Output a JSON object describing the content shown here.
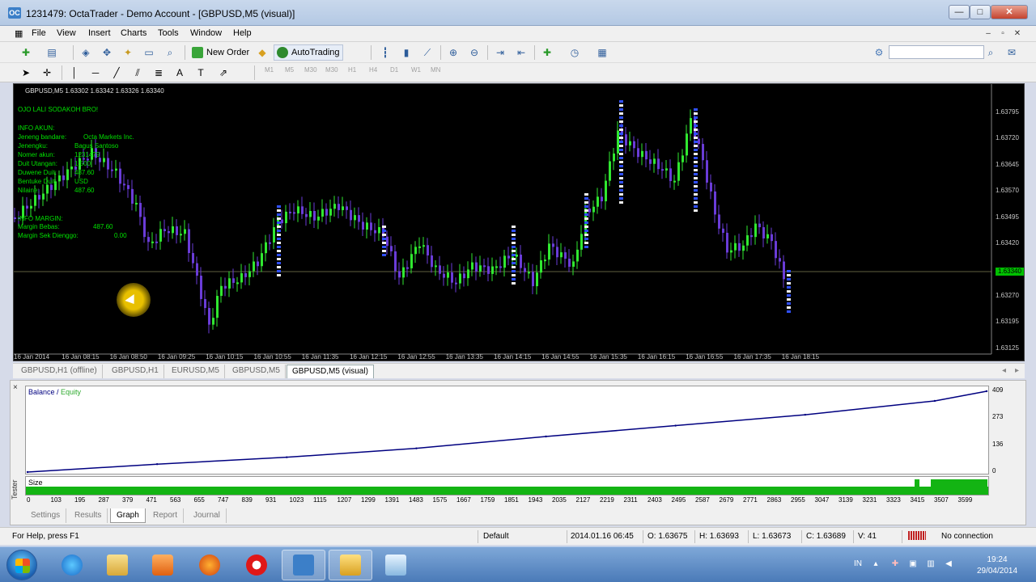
{
  "window": {
    "title": "1231479: OctaTrader - Demo Account - [GBPUSD,M5 (visual)]",
    "app_icon": "OC",
    "controls": {
      "minimize": "—",
      "maximize": "□",
      "close": "✕"
    },
    "mdi_controls": {
      "minimize": "–",
      "restore": "▫",
      "close": "✕"
    }
  },
  "menu": [
    "File",
    "View",
    "Insert",
    "Charts",
    "Tools",
    "Window",
    "Help"
  ],
  "toolbar": {
    "new_order": "New Order",
    "autotrading": "AutoTrading",
    "timeframes": [
      "M1",
      "M5",
      "M30",
      "H1",
      "H4",
      "D1",
      "W1",
      "MN"
    ],
    "search_placeholder": ""
  },
  "chart": {
    "header": "GBPUSD,M5  1.63302 1.63342 1.63326 1.63340",
    "overlay": {
      "line1": "OJO LALI SODAKOH BRO!",
      "info_akun": "INFO AKUN:",
      "rows": [
        {
          "label": "Jeneng bandare:",
          "value": "Octa Markets Inc."
        },
        {
          "label": "Jenengku:",
          "value": "Bagus Santoso"
        },
        {
          "label": "Nomer akun:",
          "value": "1231479"
        },
        {
          "label": "Duit Utangan:",
          "value": "1:500"
        },
        {
          "label": "Duwene Duit:",
          "value": "487.60"
        },
        {
          "label": "Bentuke Duit:",
          "value": "USD"
        },
        {
          "label": "Nilaine:",
          "value": "487.60"
        }
      ],
      "info_margin": "INFO MARGIN:",
      "margin_rows": [
        {
          "label": "Margin Bebas:",
          "value": "487.60"
        },
        {
          "label": "Margin Sek Dienggo:",
          "value": "0.00"
        }
      ]
    },
    "price_labels": [
      "1.63795",
      "1.63720",
      "1.63645",
      "1.63570",
      "1.63495",
      "1.63420",
      "1.63340",
      "1.63270",
      "1.63195",
      "1.63125"
    ],
    "current_price": "1.63340",
    "time_labels": [
      "16 Jan 2014",
      "16 Jan 08:15",
      "16 Jan 08:50",
      "16 Jan 09:25",
      "16 Jan 10:15",
      "16 Jan 10:55",
      "16 Jan 11:35",
      "16 Jan 12:15",
      "16 Jan 12:55",
      "16 Jan 13:35",
      "16 Jan 14:15",
      "16 Jan 14:55",
      "16 Jan 15:35",
      "16 Jan 16:15",
      "16 Jan 16:55",
      "16 Jan 17:35",
      "16 Jan 18:15"
    ],
    "colors": {
      "bull": "#30e830",
      "bear": "#6a3cd8",
      "grid": "#1e3a1e",
      "text": "#c8c8c8"
    }
  },
  "chart_tabs": [
    "GBPUSD,H1 (offline)",
    "GBPUSD,H1",
    "EURUSD,M5",
    "GBPUSD,M5",
    "GBPUSD,M5 (visual)"
  ],
  "active_chart_tab": 4,
  "tester": {
    "side_label": "Tester",
    "close": "×",
    "legend_balance": "Balance",
    "legend_sep": " / ",
    "legend_equity": "Equity",
    "y_labels": [
      "409",
      "273",
      "136",
      "0"
    ],
    "size_label": "Size",
    "x_labels": [
      "0",
      "103",
      "195",
      "287",
      "379",
      "471",
      "563",
      "655",
      "747",
      "839",
      "931",
      "1023",
      "1115",
      "1207",
      "1299",
      "1391",
      "1483",
      "1575",
      "1667",
      "1759",
      "1851",
      "1943",
      "2035",
      "2127",
      "2219",
      "2311",
      "2403",
      "2495",
      "2587",
      "2679",
      "2771",
      "2863",
      "2955",
      "3047",
      "3139",
      "3231",
      "3323",
      "3415",
      "3507",
      "3599"
    ],
    "tabs": [
      "Settings",
      "Results",
      "Graph",
      "Report",
      "Journal"
    ],
    "active_tab": 2
  },
  "chart_data": {
    "type": "line",
    "series": [
      {
        "name": "Balance",
        "x": [
          0,
          500,
          1000,
          1500,
          2000,
          2500,
          3000,
          3500,
          3700
        ],
        "values": [
          0,
          40,
          75,
          120,
          180,
          235,
          290,
          360,
          409
        ]
      }
    ],
    "ylim": [
      0,
      409
    ],
    "y_ticks": [
      0,
      136,
      273,
      409
    ],
    "legend": "top-left"
  },
  "status": {
    "help": "For Help, press F1",
    "profile": "Default",
    "datetime": "2014.01.16 06:45",
    "open": "O: 1.63675",
    "high": "H: 1.63693",
    "low": "L: 1.63673",
    "close": "C: 1.63689",
    "volume": "V: 41",
    "connection": "No connection"
  },
  "taskbar": {
    "lang": "IN",
    "time": "19:24",
    "date": "29/04/2014"
  }
}
